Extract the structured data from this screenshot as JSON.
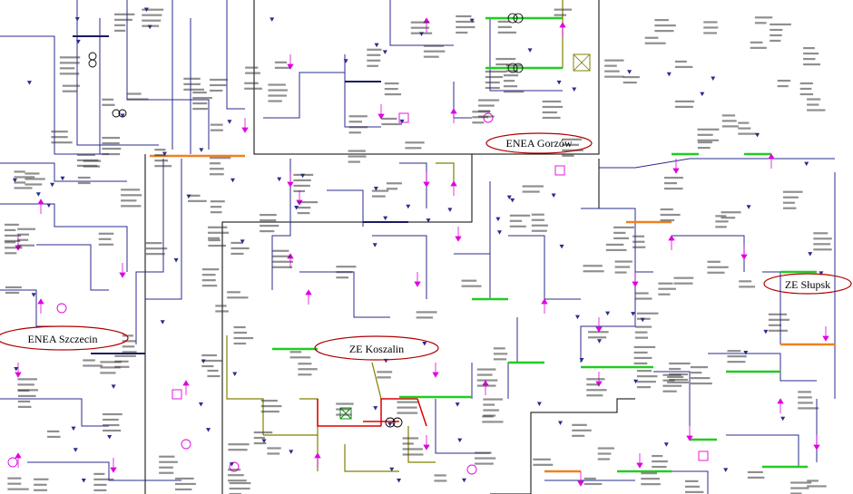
{
  "diagram": {
    "region_labels": [
      {
        "id": "enea-gorzow",
        "text": "ENEA Gorzów"
      },
      {
        "id": "enea-szczecin",
        "text": "ENEA Szczecin"
      },
      {
        "id": "ze-koszalin",
        "text": "ZE Koszalin"
      },
      {
        "id": "ze-slupsk",
        "text": "ZE Słupsk"
      }
    ],
    "colors": {
      "line_dark": "#1a1a60",
      "line_navy": "#2b2b8f",
      "bus_green": "#22cc22",
      "bus_orange": "#f08020",
      "bus_olive": "#808000",
      "bus_red": "#dd0000",
      "flow_magenta": "#e000e0",
      "region_oval": "#b00000"
    }
  }
}
